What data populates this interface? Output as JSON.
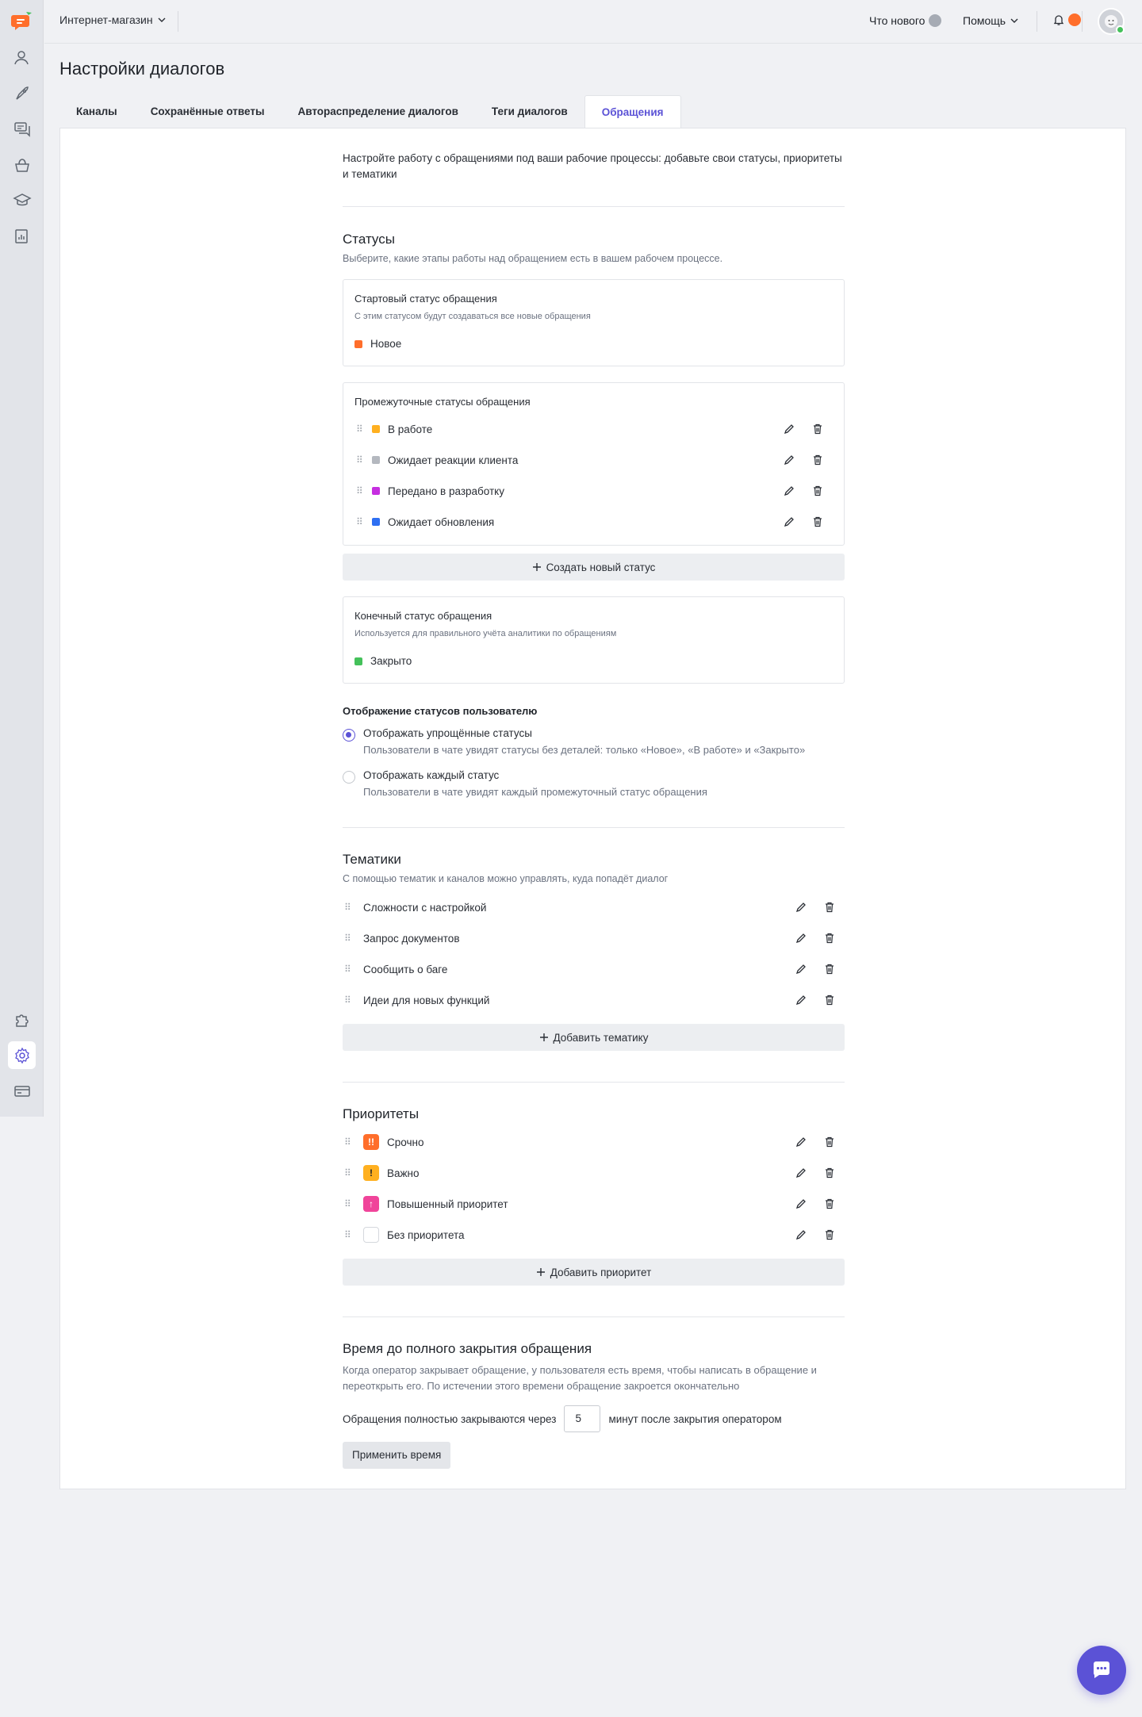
{
  "topbar": {
    "project": "Интернет-магазин",
    "whats_new": "Что нового",
    "whats_new_count": "",
    "help": "Помощь",
    "notifications_count": ""
  },
  "page": {
    "title": "Настройки диалогов"
  },
  "tabs": [
    {
      "label": "Каналы"
    },
    {
      "label": "Сохранённые ответы"
    },
    {
      "label": "Автораспределение диалогов"
    },
    {
      "label": "Теги диалогов"
    },
    {
      "label": "Обращения",
      "active": true
    }
  ],
  "intro": "Настройте работу с обращениями под ваши рабочие процессы: добавьте свои статусы, приоритеты и тематики",
  "statuses": {
    "title": "Статусы",
    "subtitle": "Выберите, какие этапы работы над обращением есть в вашем рабочем процессе.",
    "start": {
      "title": "Стартовый статус обращения",
      "subtitle": "С этим статусом будут создаваться все новые обращения",
      "name": "Новое",
      "color": "#ff6e2b"
    },
    "intermediate": {
      "title": "Промежуточные статусы обращения",
      "items": [
        {
          "name": "В работе",
          "color": "#ffb020"
        },
        {
          "name": "Ожидает реакции клиента",
          "color": "#b4b8bf"
        },
        {
          "name": "Передано в разработку",
          "color": "#c62ee0"
        },
        {
          "name": "Ожидает обновления",
          "color": "#2e6ff2"
        }
      ]
    },
    "create_button": "Создать новый статус",
    "final": {
      "title": "Конечный статус обращения",
      "subtitle": "Используется для правильного учёта аналитики по обращениям",
      "name": "Закрыто",
      "color": "#44c15a"
    },
    "display": {
      "title": "Отображение статусов пользователю",
      "options": [
        {
          "label": "Отображать упрощённые статусы",
          "description": "Пользователи в чате увидят статусы без деталей: только «Новое», «В работе» и «Закрыто»",
          "selected": true
        },
        {
          "label": "Отображать каждый статус",
          "description": "Пользователи в чате увидят каждый промежуточный статус обращения",
          "selected": false
        }
      ]
    }
  },
  "topics": {
    "title": "Тематики",
    "subtitle": "С помощью тематик и каналов можно управлять, куда попадёт диалог",
    "items": [
      {
        "name": "Сложности с настройкой"
      },
      {
        "name": "Запрос документов"
      },
      {
        "name": "Сообщить о баге"
      },
      {
        "name": "Идеи для новых функций"
      }
    ],
    "add_button": "Добавить тематику"
  },
  "priorities": {
    "title": "Приоритеты",
    "items": [
      {
        "name": "Срочно",
        "icon": "double-exclamation-icon",
        "glyph": "!!",
        "color": "#ff6e2b"
      },
      {
        "name": "Важно",
        "icon": "exclamation-icon",
        "glyph": "!",
        "color": "#ffb020"
      },
      {
        "name": "Повышенный приоритет",
        "icon": "arrow-up-icon",
        "glyph": "↑",
        "color": "#f0449a"
      },
      {
        "name": "Без приоритета",
        "icon": "empty-priority-icon",
        "glyph": "",
        "color": "#ffffff"
      }
    ],
    "add_button": "Добавить приоритет"
  },
  "closing": {
    "title": "Время до полного закрытия обращения",
    "description": "Когда оператор закрывает обращение, у пользователя есть время, чтобы написать в обращение и переоткрыть его. По истечении этого времени обращение закроется окончательно",
    "prefix": "Обращения полностью закрываются через",
    "value": "5",
    "suffix": "минут после закрытия оператором",
    "apply_button": "Применить время"
  },
  "colors": {
    "accent": "#5b52d6",
    "brand_orange": "#ff6e2b",
    "online": "#44c15a"
  }
}
